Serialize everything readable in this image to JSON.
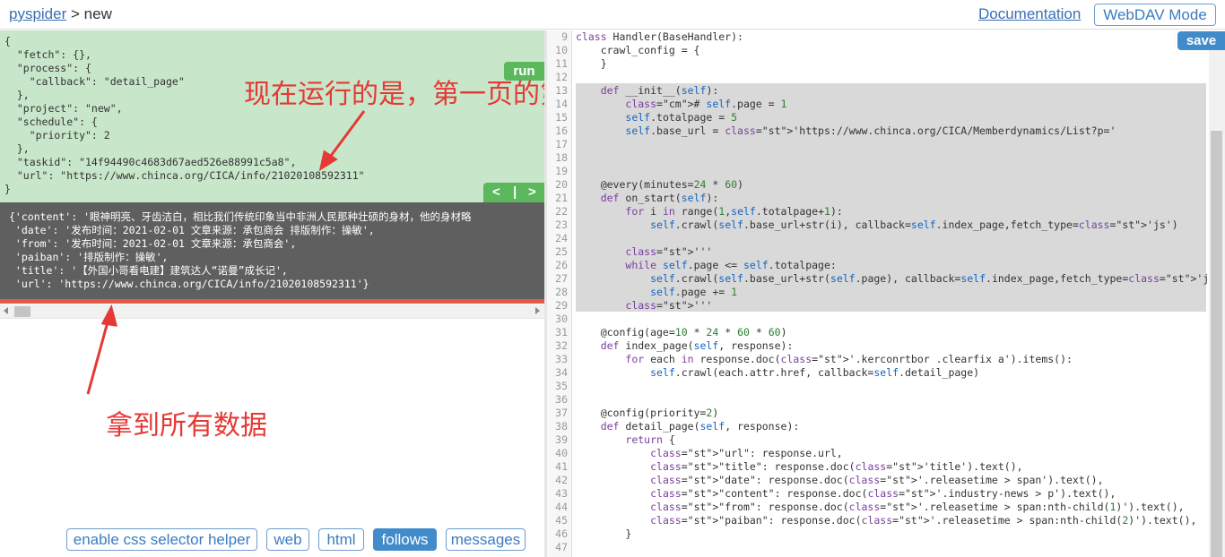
{
  "header": {
    "crumb_project": "pyspider",
    "crumb_sep": ">",
    "crumb_page": "new",
    "documentation": "Documentation",
    "webdav": "WebDAV Mode"
  },
  "task_panel": {
    "run_label": "run",
    "lines": [
      "{",
      "  \"fetch\": {},",
      "  \"process\": {",
      "    \"callback\": \"detail_page\"",
      "  },",
      "  \"project\": \"new\",",
      "  \"schedule\": {",
      "    \"priority\": 2",
      "  },",
      "  \"taskid\": \"14f94490c4683d67aed526e88991c5a8\",",
      "  \"url\": \"https://www.chinca.org/CICA/info/21020108592311\"",
      "}"
    ],
    "nav_prev": "<",
    "nav_sep": "|",
    "nav_next": ">"
  },
  "result_panel": {
    "lines": [
      "{'content': '眼神明亮、牙齿洁白，相比我们传统印象当中非洲人民那种壮硕的身材，他的身材略",
      " 'date': '发布时间：2021-02-01 文章来源：承包商会 排版制作：操敏',",
      " 'from': '发布时间：2021-02-01 文章来源：承包商会',",
      " 'paiban': '排版制作：操敏',",
      " 'title': '【外国小哥看电建】建筑达人“诺曼”成长记',",
      " 'url': 'https://www.chinca.org/CICA/info/21020108592311'}"
    ]
  },
  "annotations": {
    "top": "现在运行的是，第一页的第一个",
    "bottom": "拿到所有数据"
  },
  "tabs": [
    {
      "label": "enable css selector helper",
      "active": false
    },
    {
      "label": "web",
      "active": false
    },
    {
      "label": "html",
      "active": false
    },
    {
      "label": "follows",
      "active": true
    },
    {
      "label": "messages",
      "active": false
    }
  ],
  "editor": {
    "save_label": "save",
    "line_numbers": [
      "9",
      "10",
      "11",
      "12",
      "13",
      "14",
      "15",
      "16",
      "17",
      "18",
      "19",
      "20",
      "21",
      "22",
      "23",
      "24",
      "25",
      "26",
      "27",
      "28",
      "29",
      "30",
      "31",
      "32",
      "33",
      "34",
      "35",
      "36",
      "37",
      "38",
      "39",
      "40",
      "41",
      "42",
      "43",
      "44",
      "45",
      "46",
      "47"
    ],
    "lines": [
      "class Handler(BaseHandler):",
      "    crawl_config = {",
      "    }",
      "",
      "    def __init__(self):",
      "        # self.page = 1",
      "        self.totalpage = 5",
      "        self.base_url = 'https://www.chinca.org/CICA/Memberdynamics/List?p='",
      "",
      "",
      "",
      "    @every(minutes=24 * 60)",
      "    def on_start(self):",
      "        for i in range(1,self.totalpage+1):",
      "            self.crawl(self.base_url+str(i), callback=self.index_page,fetch_type='js')",
      "",
      "        '''",
      "        while self.page <= self.totalpage:",
      "            self.crawl(self.base_url+str(self.page), callback=self.index_page,fetch_type='js')",
      "            self.page += 1",
      "        '''",
      "",
      "    @config(age=10 * 24 * 60 * 60)",
      "    def index_page(self, response):",
      "        for each in response.doc('.kerconrtbor .clearfix a').items():",
      "            self.crawl(each.attr.href, callback=self.detail_page)",
      "",
      "",
      "    @config(priority=2)",
      "    def detail_page(self, response):",
      "        return {",
      "            \"url\": response.url,",
      "            \"title\": response.doc('title').text(),",
      "            \"date\": response.doc('.releasetime > span').text(),",
      "            \"content\": response.doc('.industry-news > p').text(),",
      "            \"from\": response.doc('.releasetime > span:nth-child(1)').text(),",
      "            \"paiban\": response.doc('.releasetime > span:nth-child(2)').text(),",
      "        }",
      ""
    ]
  },
  "colors": {
    "task_bg": "#c8e6c9",
    "result_bg": "#5f5f5f",
    "annotation_red": "#e53935",
    "button_green": "#5cb85c",
    "button_blue": "#428bca",
    "highlight": "#d9d9d9"
  }
}
